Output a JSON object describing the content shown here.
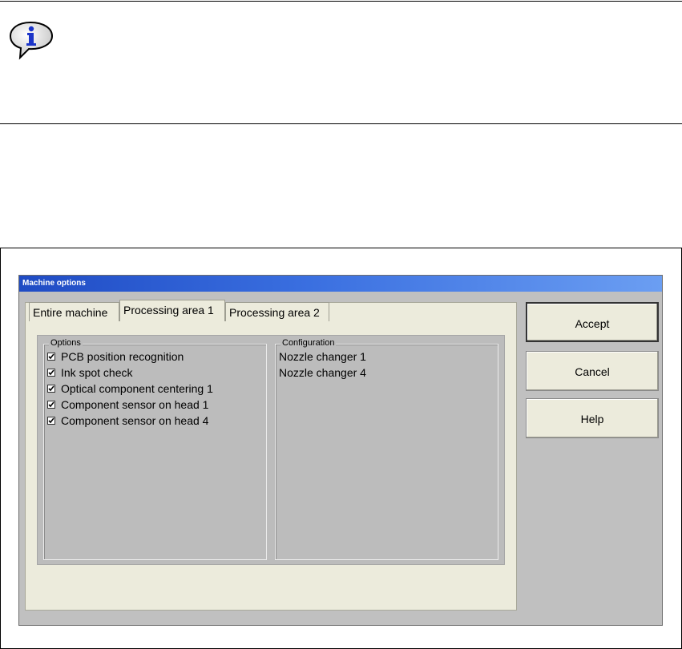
{
  "dialog": {
    "title": "Machine options",
    "tabs": [
      {
        "label": "Entire machine"
      },
      {
        "label": "Processing area 1"
      },
      {
        "label": "Processing area 2"
      }
    ],
    "active_tab": "Processing area 1",
    "options": {
      "legend": "Options",
      "items": [
        {
          "label": "PCB position recognition",
          "checked": true
        },
        {
          "label": "Ink spot check",
          "checked": true
        },
        {
          "label": "Optical component centering 1",
          "checked": true
        },
        {
          "label": "Component sensor on head 1",
          "checked": true
        },
        {
          "label": "Component sensor on head 4",
          "checked": true
        }
      ]
    },
    "configuration": {
      "legend": "Configuration",
      "items": [
        "Nozzle changer 1",
        "Nozzle changer 4"
      ]
    },
    "buttons": {
      "accept": "Accept",
      "cancel": "Cancel",
      "help": "Help"
    }
  },
  "icons": {
    "info": "info-speech-bubble-icon",
    "checkbox": "check-icon"
  },
  "colors": {
    "titlebar": "#1f4bc4",
    "panel": "#ecebdc",
    "content": "#bcbcbc",
    "info_icon": "#1c35c8"
  }
}
